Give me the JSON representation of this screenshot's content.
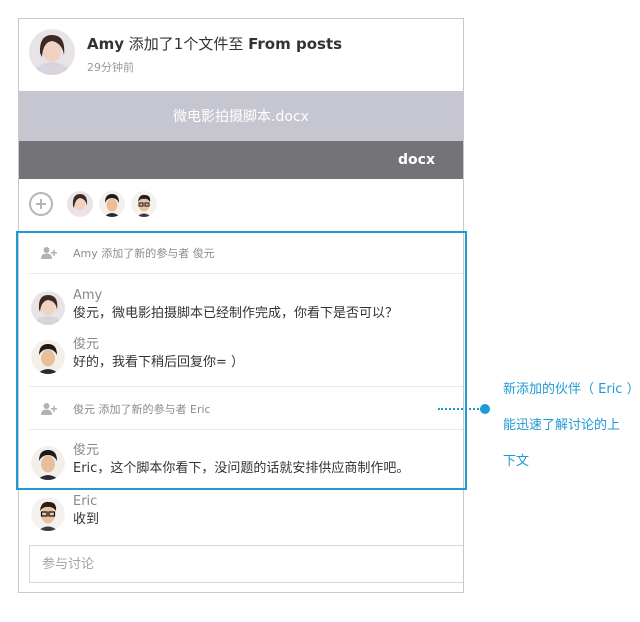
{
  "post": {
    "author": "Amy",
    "action": " 添加了1个文件至 ",
    "destination": "From posts",
    "time_ago": "29分钟前"
  },
  "file": {
    "name": "微电影拍摄脚本.docx",
    "type": "docx"
  },
  "participants": {
    "add_icon": "add-circle-icon",
    "avatars": [
      "Amy",
      "俊元",
      "Eric"
    ]
  },
  "activity": [
    {
      "kind": "system",
      "icon": "add-user-icon",
      "text": "Amy 添加了新的参与者 俊元"
    },
    {
      "kind": "message",
      "author": "Amy",
      "text": "俊元，微电影拍摄脚本已经制作完成，你看下是否可以？"
    },
    {
      "kind": "message",
      "author": "俊元",
      "text": "好的，我看下稍后回复你= ）"
    },
    {
      "kind": "system",
      "icon": "add-user-icon",
      "text": "俊元  添加了新的参与者  Eric"
    },
    {
      "kind": "message",
      "author": "俊元",
      "text": "Eric，这个脚本你看下，没问题的话就安排供应商制作吧。"
    },
    {
      "kind": "message",
      "author": "Eric",
      "text": "收到"
    }
  ],
  "comment": {
    "placeholder": "参与讨论"
  },
  "annotation": {
    "lines": [
      "新添加的伙伴（ Eric ）",
      "能迅速了解讨论的上",
      "下文"
    ],
    "color": "#1e9ad6"
  }
}
